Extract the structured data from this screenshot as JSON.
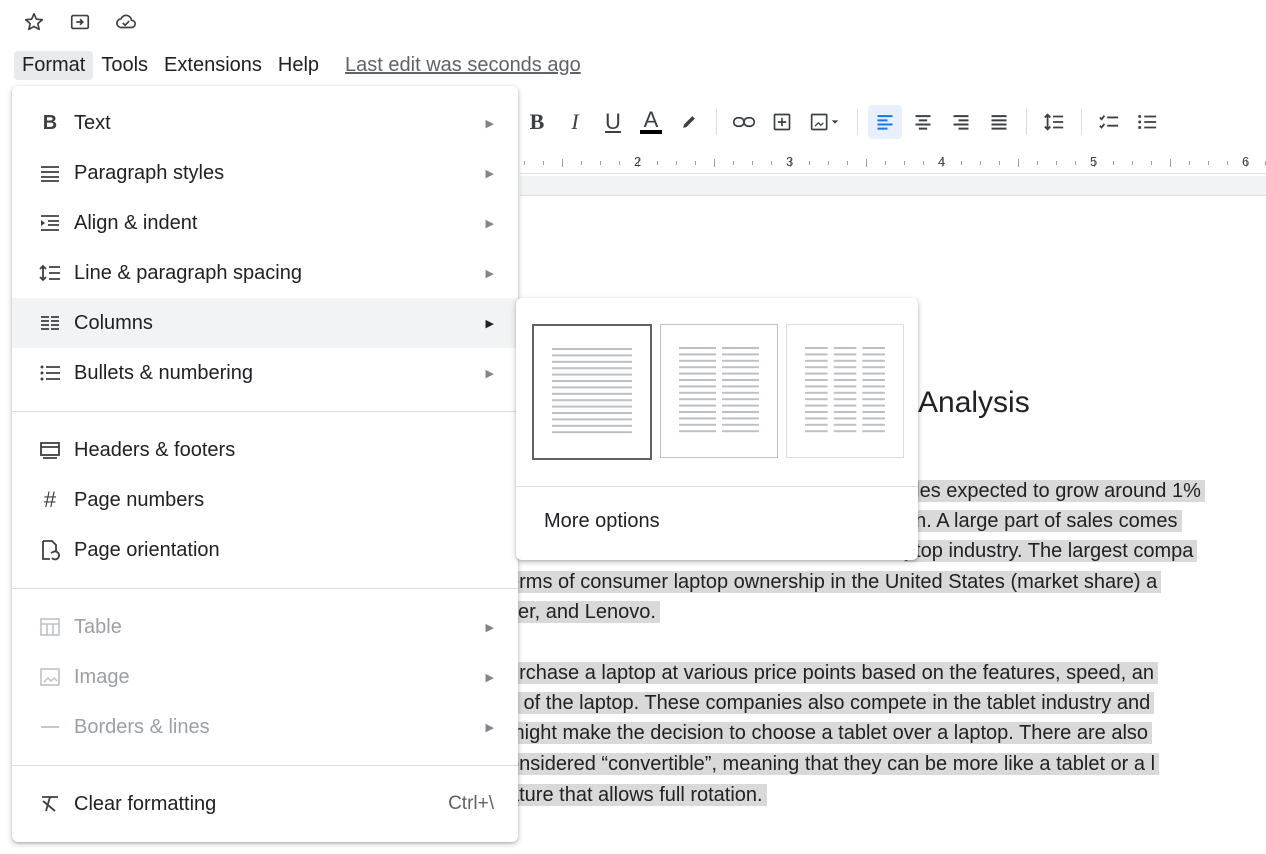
{
  "top_icons": [
    "star-icon",
    "move-to-folder-icon",
    "cloud-saved-icon"
  ],
  "menubar": {
    "items": [
      {
        "label": "Format",
        "active": true
      },
      {
        "label": "Tools",
        "active": false
      },
      {
        "label": "Extensions",
        "active": false
      },
      {
        "label": "Help",
        "active": false
      }
    ],
    "last_edit": "Last edit was seconds ago"
  },
  "toolbar": {
    "bold": "B",
    "italic": "I",
    "underline": "U",
    "text_color": "A"
  },
  "ruler": {
    "numbers": [
      "2",
      "3",
      "4",
      "5",
      "6"
    ]
  },
  "document": {
    "title": "Analysis",
    "lines": [
      "ales expected to grow around 1%",
      "on.  A large part of sales comes",
      "ptop industry.  The largest compa",
      "erms of consumer laptop ownership in the United States (market share) a",
      "cer, and Lenovo.",
      "urchase a laptop at various price points based on the features, speed, an",
      "s of the laptop. These companies also compete in the tablet industry and",
      "might make the decision to choose a tablet over a laptop.  There are also",
      "onsidered “convertible”, meaning that they can be more like a tablet or a l",
      "ature that allows full rotation."
    ]
  },
  "format_menu": {
    "group1": [
      {
        "label": "Text",
        "icon": "bold-icon",
        "glyph": "B",
        "submenu": true
      },
      {
        "label": "Paragraph styles",
        "icon": "paragraph-styles-icon",
        "glyph": "≣",
        "submenu": true
      },
      {
        "label": "Align & indent",
        "icon": "align-indent-icon",
        "glyph": "⇥",
        "submenu": true
      },
      {
        "label": "Line & paragraph spacing",
        "icon": "line-spacing-icon",
        "glyph": "↕",
        "submenu": true
      },
      {
        "label": "Columns",
        "icon": "columns-icon",
        "glyph": "▥",
        "submenu": true,
        "hover": true
      },
      {
        "label": "Bullets & numbering",
        "icon": "bulleted-list-icon",
        "glyph": "☰",
        "submenu": true
      }
    ],
    "group2": [
      {
        "label": "Headers & footers",
        "icon": "headers-footers-icon",
        "glyph": "▭"
      },
      {
        "label": "Page numbers",
        "icon": "hash-icon",
        "glyph": "#"
      },
      {
        "label": "Page orientation",
        "icon": "page-orientation-icon",
        "glyph": "⟲"
      }
    ],
    "group3": [
      {
        "label": "Table",
        "icon": "table-icon",
        "glyph": "▦",
        "submenu": true,
        "disabled": true
      },
      {
        "label": "Image",
        "icon": "image-icon",
        "glyph": "▣",
        "submenu": true,
        "disabled": true
      },
      {
        "label": "Borders & lines",
        "icon": "borders-lines-icon",
        "glyph": "—",
        "submenu": true,
        "disabled": true
      }
    ],
    "clear_formatting": {
      "label": "Clear formatting",
      "icon": "clear-formatting-icon",
      "glyph": "X̶",
      "shortcut": "Ctrl+\\"
    }
  },
  "columns_submenu": {
    "options": [
      {
        "name": "one-column-option",
        "columns": 1,
        "selected": true
      },
      {
        "name": "two-column-option",
        "columns": 2,
        "selected": false
      },
      {
        "name": "three-column-option",
        "columns": 3,
        "selected": false
      }
    ],
    "more_options": "More options"
  },
  "colors": {
    "accent_blue": "#1a73e8",
    "hover_gray": "#f1f3f4",
    "selection_gray": "#d9d9d9"
  }
}
